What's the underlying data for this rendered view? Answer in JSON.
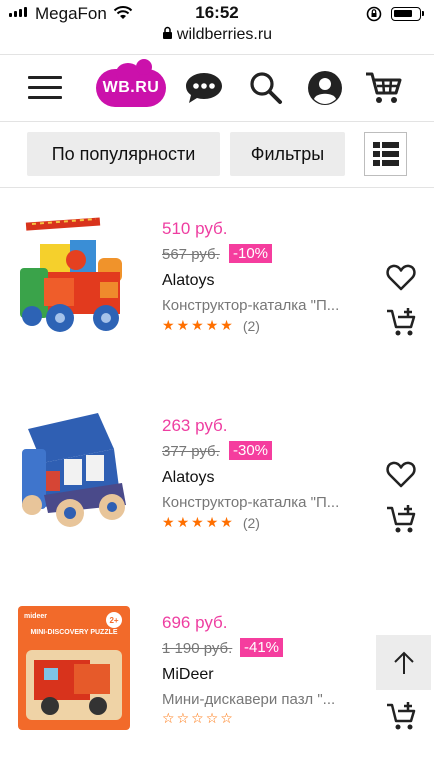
{
  "status_bar": {
    "carrier": "MegaFon",
    "time": "16:52"
  },
  "browser": {
    "url": "wildberries.ru"
  },
  "header": {
    "logo_text": "WB.RU"
  },
  "toolbar": {
    "sort_label": "По популярности",
    "filter_label": "Фильтры"
  },
  "products": [
    {
      "price": "510 руб.",
      "old_price": "567 руб.",
      "discount": "-10%",
      "brand": "Alatoys",
      "name": "Конструктор-каталка \"П...",
      "rating": 5,
      "reviews": "(2)"
    },
    {
      "price": "263 руб.",
      "old_price": "377 руб.",
      "discount": "-30%",
      "brand": "Alatoys",
      "name": "Конструктор-каталка \"П...",
      "rating": 5,
      "reviews": "(2)"
    },
    {
      "price": "696 руб.",
      "old_price": "1 190 руб.",
      "discount": "-41%",
      "brand": "MiDeer",
      "name": "Мини-дискавери пазл \"...",
      "rating": 0,
      "reviews": "",
      "image_text": {
        "brand": "mideer",
        "title": "MINI-DISCOVERY PUZZLE",
        "age": "2+"
      }
    }
  ],
  "colors": {
    "accent": "#cb11ab",
    "price": "#ee3ea1",
    "discount_bg": "#f53d9e",
    "stars": "#ff6f00"
  }
}
